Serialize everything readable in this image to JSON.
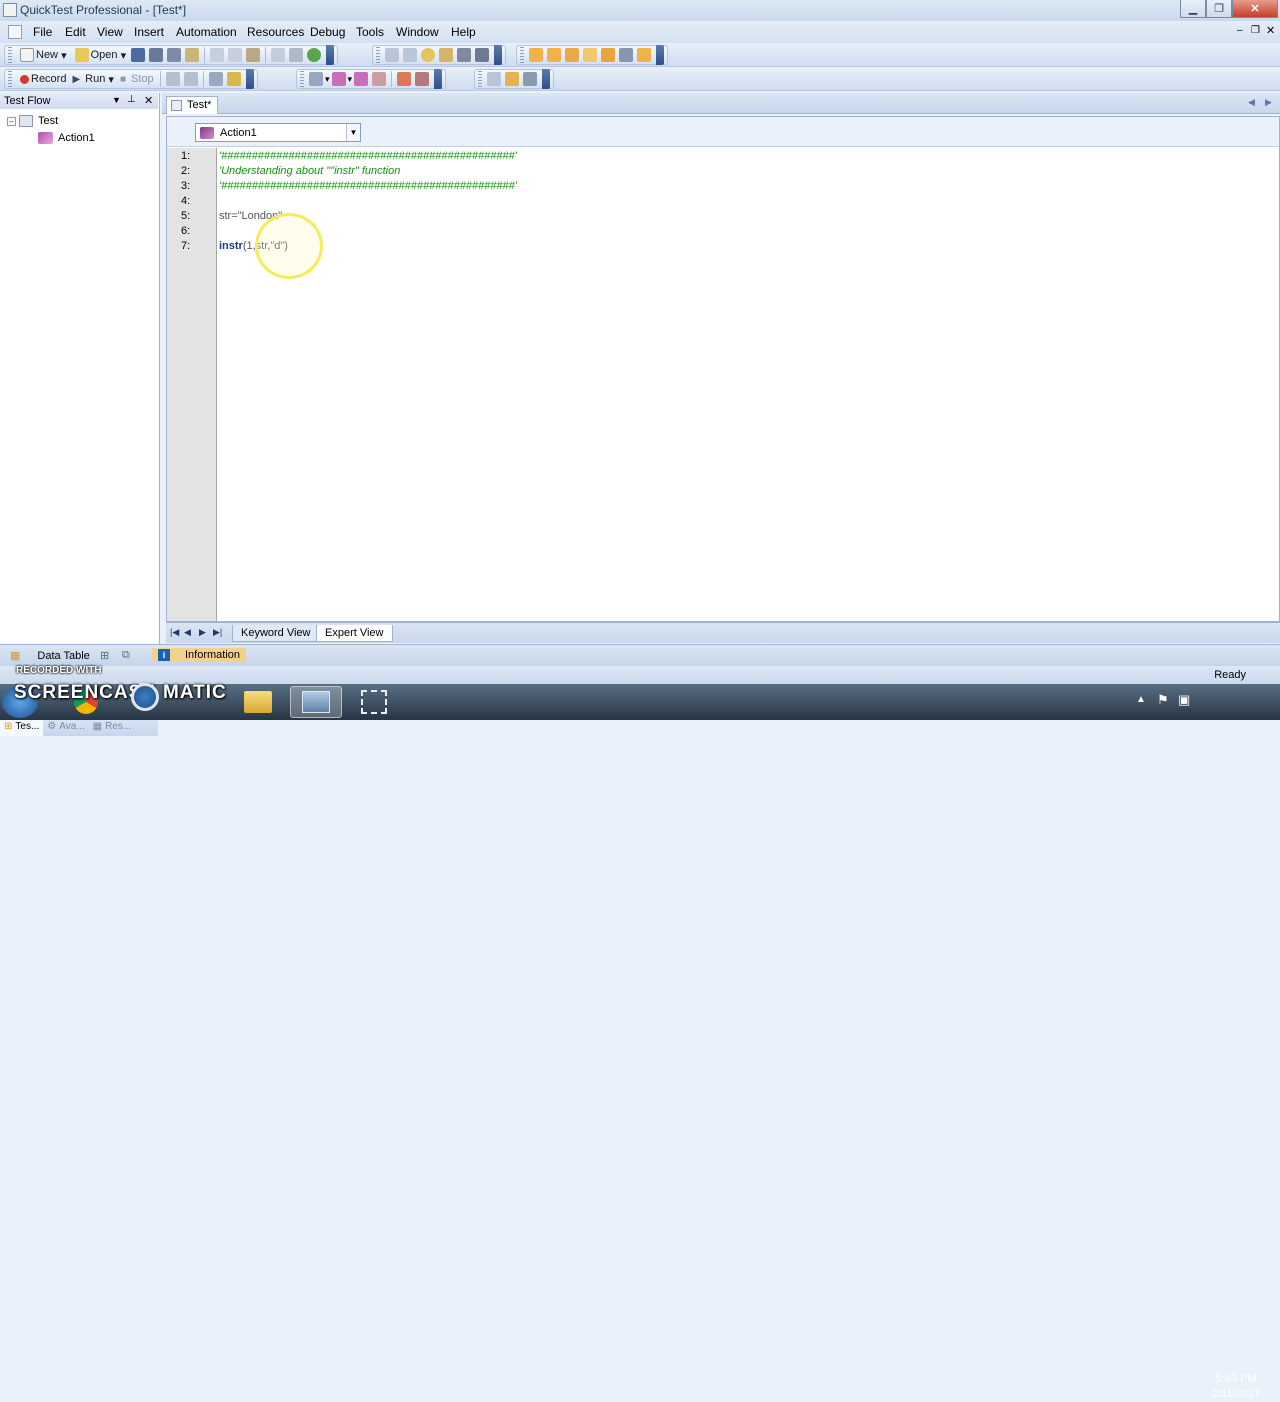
{
  "window": {
    "title": "QuickTest Professional - [Test*]"
  },
  "menu": [
    "File",
    "Edit",
    "View",
    "Insert",
    "Automation",
    "Resources",
    "Debug",
    "Tools",
    "Window",
    "Help"
  ],
  "toolbar1": {
    "new_label": "New",
    "open_label": "Open"
  },
  "toolbar2": {
    "record_label": "Record",
    "run_label": "Run",
    "stop_label": "Stop"
  },
  "test_flow": {
    "title": "Test Flow",
    "root": "Test",
    "child": "Action1"
  },
  "left_tabs": [
    "Tes...",
    "Ava...",
    "Res..."
  ],
  "doc_tab": {
    "label": "Test*"
  },
  "action_select": {
    "value": "Action1"
  },
  "code_lines": [
    {
      "num": "1:",
      "text": "'################################################'"
    },
    {
      "num": "2:",
      "text": "'Understanding about \"\"instr\" function"
    },
    {
      "num": "3:",
      "text": "'################################################'"
    },
    {
      "num": "4:",
      "text": ""
    },
    {
      "num": "5:",
      "text": "str=\"London\""
    },
    {
      "num": "6:",
      "text": ""
    },
    {
      "num": "7:",
      "kw": "instr",
      "rest": "(1,str,\"d\")"
    }
  ],
  "view_tabs": {
    "keyword": "Keyword View",
    "expert": "Expert View"
  },
  "dock": {
    "data_table": "Data Table",
    "information": "Information"
  },
  "status": {
    "ready": "Ready"
  },
  "watermark": {
    "recorded": "RECORDED WITH",
    "brand_left": "SCREENCAST",
    "brand_right": "MATIC"
  },
  "clock": {
    "time": "5:49 PM",
    "date": "2/11/2017"
  },
  "colors": {
    "comment": "#169016",
    "keyword": "#1a3a8a",
    "cursor_highlight": "#f5ec5a"
  }
}
